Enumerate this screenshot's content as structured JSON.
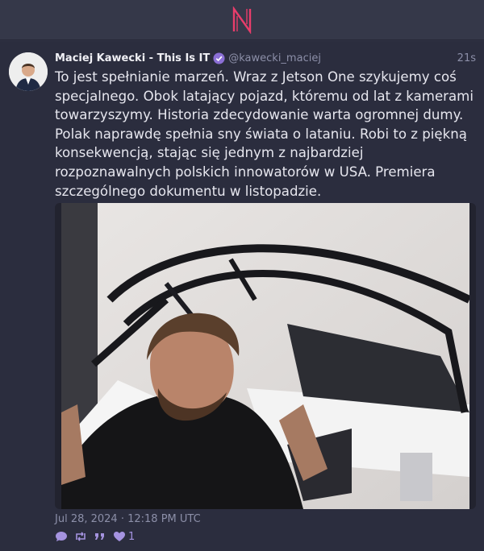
{
  "app": {
    "logo_icon": "n-logo-icon",
    "accent": "#e83d6b"
  },
  "post": {
    "author": {
      "display_name": "Maciej Kawecki - This Is IT",
      "handle": "@kawecki_maciej",
      "verified": true
    },
    "relative_time": "21s",
    "text": "To jest spełnianie marzeń. Wraz z Jetson One szykujemy coś specjalnego. Obok latający pojazd, któremu od lat z kamerami towarzyszymy. Historia zdecydowanie warta ogromnej dumy. Polak naprawdę spełnia sny świata o lataniu. Robi to z piękną konsekwencją, stając się jednym z najbardziej rozpoznawalnych polskich innowatorów w USA. Premiera szczególnego dokumentu w listopadzie.",
    "date": "Jul 28, 2024 · 12:18 PM UTC",
    "actions": {
      "reply_icon": "reply-icon",
      "repost_icon": "repost-icon",
      "quote_icon": "quote-icon",
      "like_icon": "heart-icon",
      "like_count": "1"
    },
    "colors": {
      "action": "#a593e0",
      "verified": "#8b6fd6"
    }
  }
}
